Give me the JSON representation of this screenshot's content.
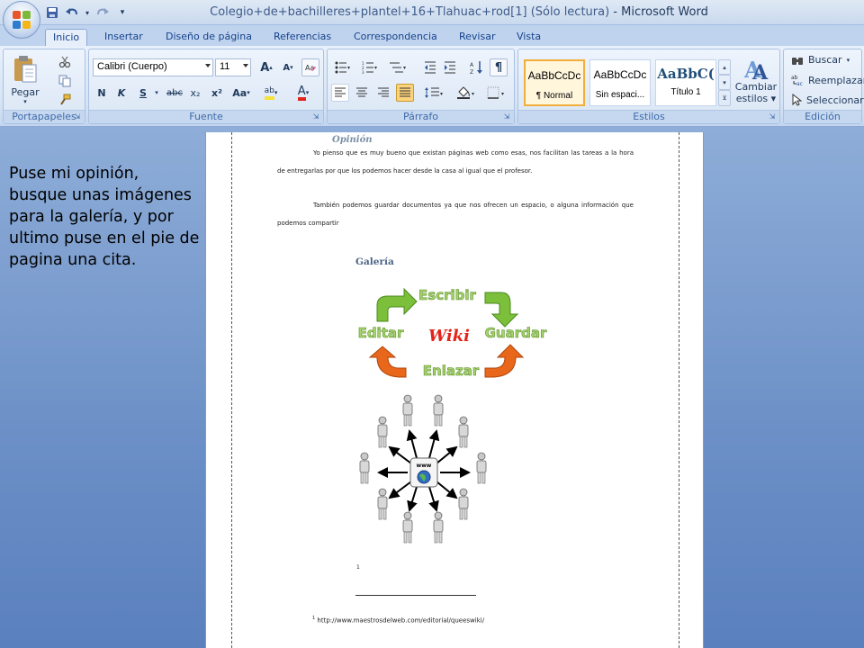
{
  "window": {
    "title_doc": "Colegio+de+bachilleres+plantel+16+Tlahuac+rod[1] (Sólo lectura)",
    "title_sep": " - ",
    "title_app": "Microsoft Word"
  },
  "tabs": [
    {
      "label": "Inicio",
      "active": true
    },
    {
      "label": "Insertar"
    },
    {
      "label": "Diseño de página"
    },
    {
      "label": "Referencias"
    },
    {
      "label": "Correspondencia"
    },
    {
      "label": "Revisar"
    },
    {
      "label": "Vista"
    }
  ],
  "ribbon": {
    "clipboard": {
      "label": "Portapapeles",
      "paste": "Pegar"
    },
    "font": {
      "label": "Fuente",
      "font_name": "Calibri (Cuerpo)",
      "font_size": "11",
      "bold": "N",
      "italic": "K",
      "underline": "S",
      "strike": "abc",
      "subscript": "x₂",
      "superscript": "x²",
      "change_case": "Aa",
      "grow": "A",
      "shrink": "A",
      "highlight": "ab",
      "font_color": "A"
    },
    "paragraph": {
      "label": "Párrafo",
      "pilcrow": "¶"
    },
    "styles": {
      "label": "Estilos",
      "items": [
        {
          "sample": "AaBbCcDc",
          "name": "¶ Normal"
        },
        {
          "sample": "AaBbCcDc",
          "name": "Sin espaci..."
        },
        {
          "sample": "AaBbC(",
          "name": "Título 1"
        }
      ],
      "change_styles": "Cambiar",
      "change_styles_2": "estilos"
    },
    "editing": {
      "label": "Edición",
      "find": "Buscar",
      "replace": "Reemplazar",
      "select": "Seleccionar"
    }
  },
  "note": "Puse mi opinión, busque unas imágenes para la galería, y por ultimo puse en el pie de pagina una cita.",
  "document": {
    "heading": "Opinión",
    "para1": "Yo pienso que es muy bueno que existan páginas web como esas, nos facilitan las tareas a la hora de entregarlas  por que los podemos hacer desde la casa al igual que el profesor.",
    "para2": "También podemos guardar documentos ya que nos ofrecen un espacio, o alguna información que podemos compartir",
    "gallery_heading": "Galería",
    "wiki_cycle": {
      "center": "Wiki",
      "top": "Escribir",
      "right": "Guardar",
      "bottom": "Enlazar",
      "left": "Editar"
    },
    "network_center": "www",
    "footnote_mark": "1",
    "footnote_num": "1",
    "footnote_url": " http://www.maestrosdelweb.com/editorial/queeswiki/"
  },
  "colors": {
    "ribbon_text": "#15428b",
    "green_arrow": "#7bbf3a",
    "orange_arrow": "#e8671a",
    "wiki_red": "#e3241b"
  }
}
